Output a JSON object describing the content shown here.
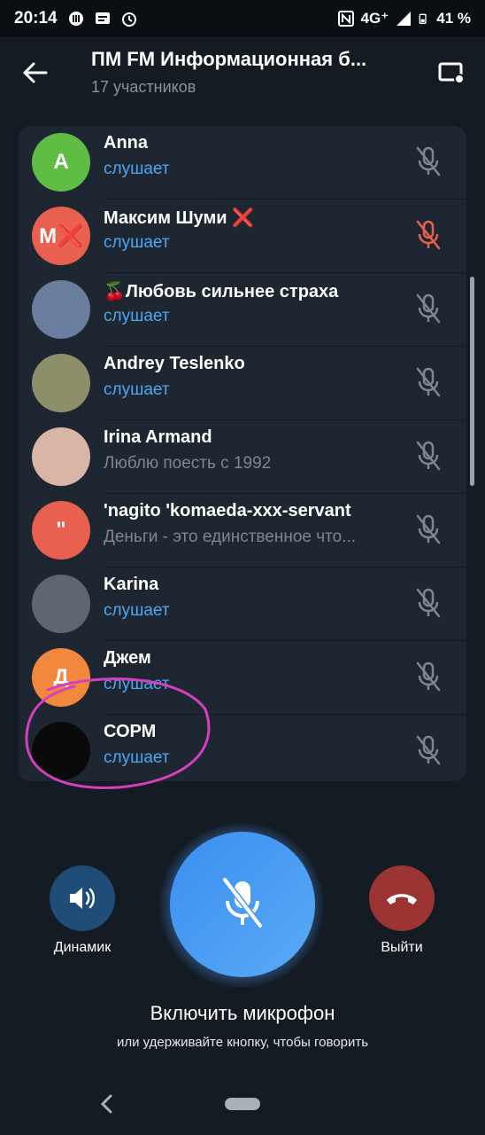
{
  "status_bar": {
    "time": "20:14",
    "network": "4G⁺",
    "battery": "41 %"
  },
  "header": {
    "title": "ПМ FM Информационная б...",
    "subtitle": "17 участников"
  },
  "participants": [
    {
      "name": "Anna",
      "status": "слушает",
      "avatar_letter": "A",
      "avatar_color": "#5fbd46",
      "muted_color": "#7d8790"
    },
    {
      "name": "Максим Шуми ❌",
      "status": "слушает",
      "avatar_letter": "M❌",
      "avatar_color": "#e8604f",
      "muted_color": "#e8604f"
    },
    {
      "name": "🍒Любовь сильнее страха",
      "status": "слушает",
      "avatar_letter": "",
      "avatar_color": "#6a7ea0",
      "muted_color": "#7d8790"
    },
    {
      "name": "Andrey Teslenko",
      "status": "слушает",
      "avatar_letter": "",
      "avatar_color": "#8c8f6a",
      "muted_color": "#7d8790"
    },
    {
      "name": "Irina Armand",
      "status": "Люблю поесть с 1992",
      "avatar_letter": "",
      "avatar_color": "#d8b5a5",
      "muted_color": "#7d8790",
      "status_gray": true
    },
    {
      "name": "'nagito 'komaeda-xxx-servant",
      "status": "Деньги - это единственное что...",
      "avatar_letter": "\"",
      "avatar_color": "#e8604f",
      "muted_color": "#7d8790",
      "status_gray": true
    },
    {
      "name": "Karina",
      "status": "слушает",
      "avatar_letter": "",
      "avatar_color": "#5f6670",
      "muted_color": "#7d8790"
    },
    {
      "name": "Джем",
      "status": "слушает",
      "avatar_letter": "Д",
      "avatar_color": "#f2883e",
      "muted_color": "#7d8790"
    },
    {
      "name": "СОРМ",
      "status": "слушает",
      "avatar_letter": "",
      "avatar_color": "#0a0a0a",
      "muted_color": "#7d8790"
    }
  ],
  "controls": {
    "speaker_label": "Динамик",
    "leave_label": "Выйти",
    "main_label": "Включить микрофон",
    "hint": "или удерживайте кнопку, чтобы говорить"
  },
  "colors": {
    "accent": "#4ea6f2",
    "danger": "#b03a3a",
    "speaker_bg": "#1f4d77"
  }
}
